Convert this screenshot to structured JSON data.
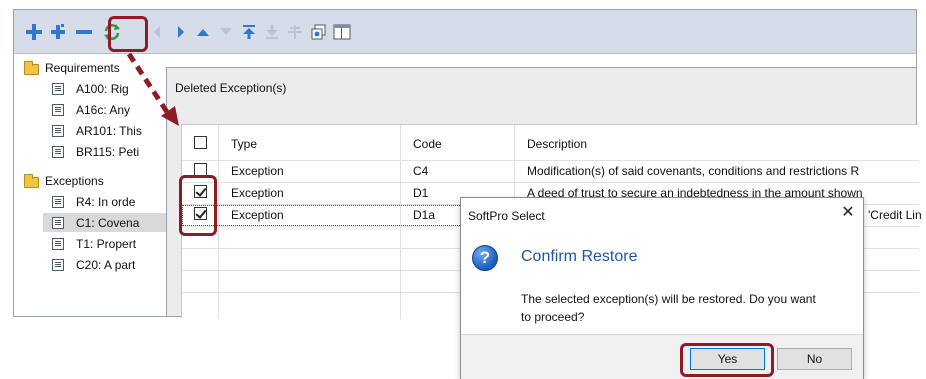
{
  "tree": {
    "groups": [
      {
        "label": "Requirements",
        "items": [
          "A100: Rig",
          "A16c: Any",
          "AR101: This",
          "BR115: Peti"
        ]
      },
      {
        "label": "Exceptions",
        "items": [
          "R4: In orde",
          "C1: Covena",
          "T1: Propert",
          "C20: A part"
        ]
      }
    ]
  },
  "deleted_window": {
    "title": "Deleted Exception(s)",
    "columns": [
      "Type",
      "Code",
      "Description"
    ],
    "rows": [
      {
        "checked": false,
        "type": "Exception",
        "code": "C4",
        "description": "Modification(s) of said covenants, conditions and restrictions   R"
      },
      {
        "checked": true,
        "type": "Exception",
        "code": "D1",
        "description": "A deed of trust to secure an indebtedness in the amount shown"
      },
      {
        "checked": true,
        "type": "Exception",
        "code": "D1a",
        "description": "'Credit Lin"
      }
    ]
  },
  "dialog": {
    "title": "SoftPro Select",
    "close_glyph": "✕",
    "icon_glyph": "?",
    "heading": "Confirm Restore",
    "message": "The selected exception(s) will be restored. Do you want to proceed?",
    "yes_label": "Yes",
    "no_label": "No"
  },
  "colors": {
    "toolbar_bg": "#d6dde8",
    "highlight": "#8c1d26",
    "dialog_heading": "#1f56a6",
    "toolbar_icon": "#3b7fd0"
  }
}
